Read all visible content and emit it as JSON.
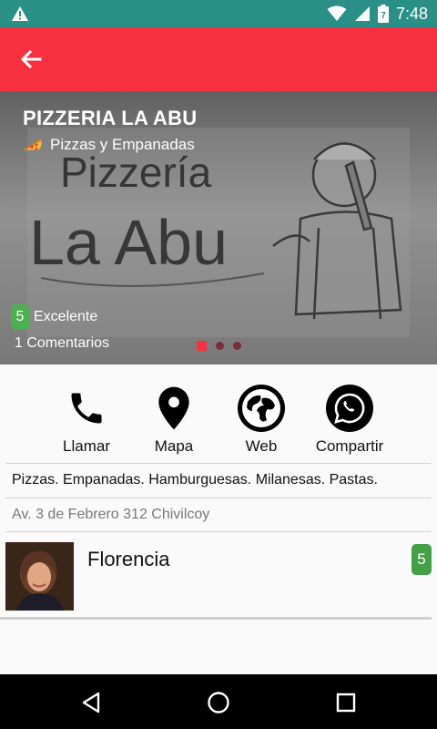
{
  "status_bar": {
    "time": "7:48",
    "battery_level": "7",
    "icons": [
      "warning-icon",
      "wifi-icon",
      "signal-icon",
      "battery-icon"
    ]
  },
  "app_bar": {
    "back_icon": "arrow-left-icon",
    "color": "#f7313f"
  },
  "restaurant": {
    "name": "PIZZERIA LA ABU",
    "category": "Pizzas y Empanadas",
    "category_icon": "pizza-icon",
    "logo_text_top": "Pizzería",
    "logo_text_bottom": "La Abu",
    "rating_value": "5",
    "rating_label": "Excelente",
    "comments": "1 Comentarios",
    "carousel_active_index": 0,
    "carousel_count": 3,
    "description": "Pizzas. Empanadas. Hamburguesas. Milanesas. Pastas.",
    "address": "Av. 3 de Febrero 312 Chivilcoy"
  },
  "actions": [
    {
      "label": "Llamar",
      "icon": "phone-icon"
    },
    {
      "label": "Mapa",
      "icon": "map-pin-icon"
    },
    {
      "label": "Web",
      "icon": "globe-icon"
    },
    {
      "label": "Compartir",
      "icon": "whatsapp-icon"
    }
  ],
  "reviews": [
    {
      "name": "Florencia",
      "score": "5"
    }
  ],
  "colors": {
    "accent": "#f7313f",
    "status_bar": "#2a8f87",
    "rating_badge": "#4caf50"
  },
  "nav_bar": {
    "icons": [
      "back-triangle-icon",
      "home-circle-icon",
      "recents-square-icon"
    ]
  }
}
